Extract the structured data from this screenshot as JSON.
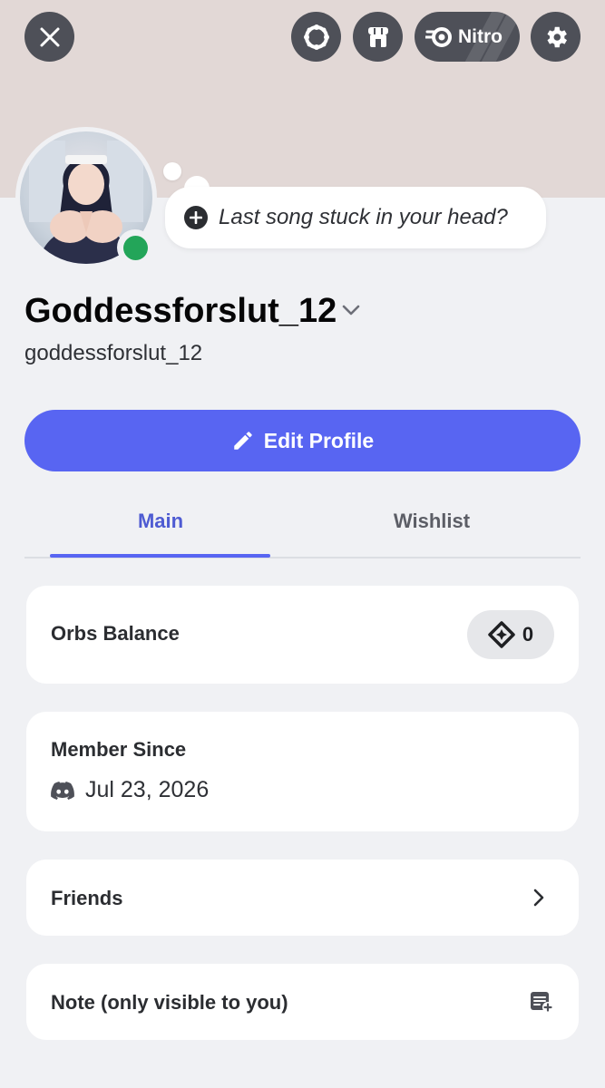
{
  "header": {
    "close_icon": "close-icon",
    "quest_icon": "quest-icon",
    "shop_icon": "shop-icon",
    "nitro_label": "Nitro",
    "settings_icon": "gear-icon",
    "banner_color": "#e2d8d6"
  },
  "profile": {
    "status_prompt": "Last song stuck in your head?",
    "display_name": "Goddessforslut_12",
    "username": "goddessforslut_12",
    "online_status_color": "#23a559"
  },
  "actions": {
    "edit_profile_label": "Edit Profile",
    "accent_color": "#5865f2"
  },
  "tabs": [
    {
      "label": "Main",
      "active": true
    },
    {
      "label": "Wishlist",
      "active": false
    }
  ],
  "cards": {
    "orbs": {
      "label": "Orbs Balance",
      "value": "0"
    },
    "member_since": {
      "label": "Member Since",
      "date": "Jul 23, 2026"
    },
    "friends": {
      "label": "Friends"
    },
    "note": {
      "label": "Note (only visible to you)"
    }
  }
}
